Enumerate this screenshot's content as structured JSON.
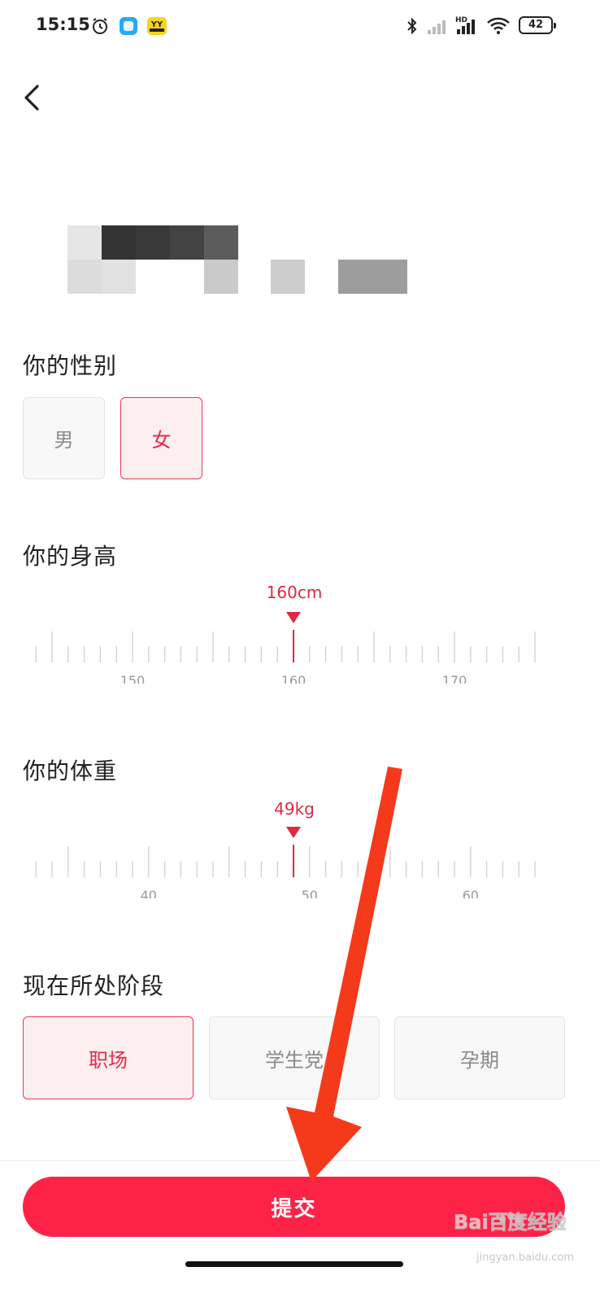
{
  "status_bar": {
    "time": "15:15",
    "battery": "42",
    "icons": [
      "alarm-icon",
      "app-icon-blue",
      "app-icon-yy",
      "bluetooth-icon",
      "signal-icon",
      "hd-signal-icon",
      "wifi-icon",
      "battery-icon"
    ]
  },
  "nav": {
    "back_icon": "chevron-left-icon"
  },
  "gender": {
    "title": "你的性别",
    "options": [
      {
        "label": "男",
        "selected": false
      },
      {
        "label": "女",
        "selected": true
      }
    ]
  },
  "height": {
    "title": "你的身高",
    "value": "160cm",
    "selected": 160,
    "tick_labels": [
      "150",
      "160",
      "170"
    ],
    "min": 143,
    "max": 175,
    "step": 1
  },
  "weight": {
    "title": "你的体重",
    "value": "49kg",
    "selected": 49,
    "tick_labels": [
      "40",
      "50",
      "60"
    ],
    "min": 32,
    "max": 64,
    "step": 1
  },
  "stage": {
    "title": "现在所处阶段",
    "options": [
      {
        "label": "职场",
        "selected": true
      },
      {
        "label": "学生党",
        "selected": false
      },
      {
        "label": "孕期",
        "selected": false
      }
    ]
  },
  "submit": {
    "label": "提交"
  },
  "watermark": {
    "logo": "Bai百度经验",
    "url": "jingyan.baidu.com"
  },
  "colors": {
    "accent": "#fd2347",
    "selected_text": "#e8294a",
    "selected_bg": "#fdeef0",
    "annotation_arrow": "#f53a1c"
  }
}
